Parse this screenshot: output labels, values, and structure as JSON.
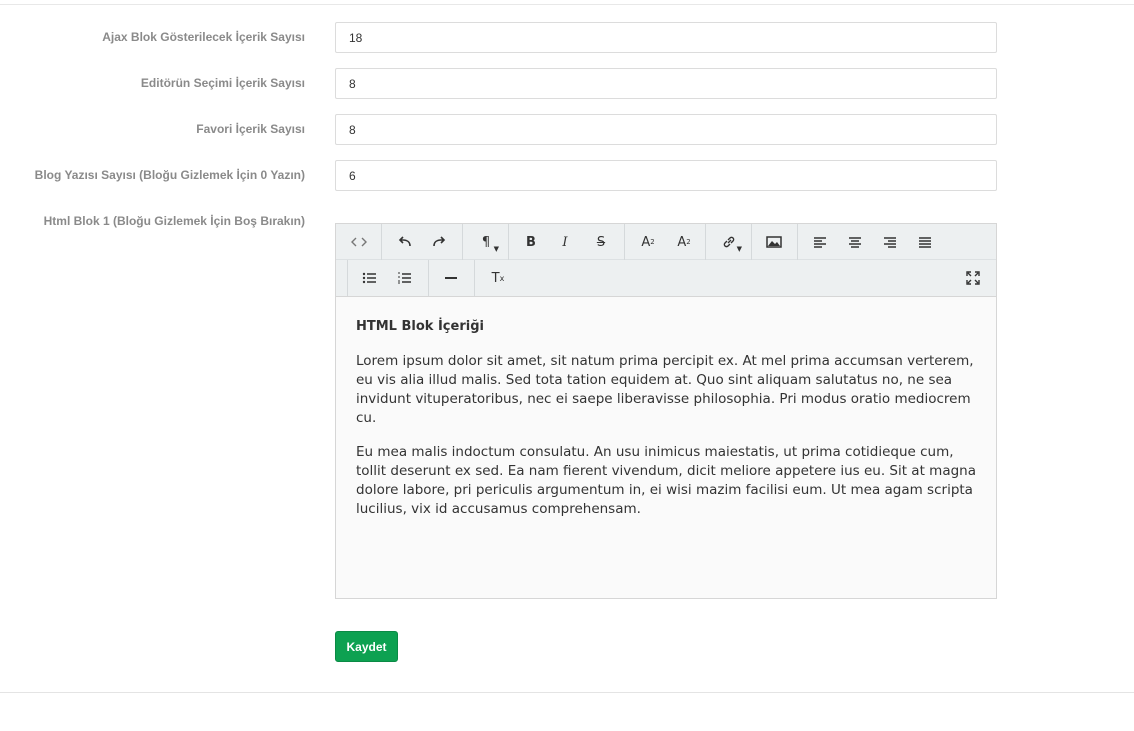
{
  "form": {
    "fields": [
      {
        "label": "Ajax Blok Gösterilecek İçerik Sayısı",
        "value": "18"
      },
      {
        "label": "Editörün Seçimi İçerik Sayısı",
        "value": "8"
      },
      {
        "label": "Favori İçerik Sayısı",
        "value": "8"
      },
      {
        "label": "Blog Yazısı Sayısı (Bloğu Gizlemek İçin 0 Yazın)",
        "value": "6"
      }
    ],
    "html_block_label": "Html Blok 1 (Bloğu Gizlemek İçin Boş Bırakın)",
    "save_label": "Kaydet"
  },
  "editor": {
    "toolbar_icons": [
      "code-view-icon",
      "undo-icon",
      "redo-icon",
      "paragraph-format-icon",
      "bold-icon",
      "italic-icon",
      "strikethrough-icon",
      "superscript-icon",
      "subscript-icon",
      "link-icon",
      "image-icon",
      "align-left-icon",
      "align-center-icon",
      "align-right-icon",
      "align-justify-icon",
      "unordered-list-icon",
      "ordered-list-icon",
      "horizontal-line-icon",
      "clear-formatting-icon",
      "fullscreen-icon"
    ],
    "heading": "HTML Blok İçeriği",
    "paragraphs": [
      "Lorem ipsum dolor sit amet, sit natum prima percipit ex. At mel prima accumsan verterem, eu vis alia illud malis. Sed tota tation equidem at. Quo sint aliquam salutatus no, ne sea invidunt vituperatoribus, nec ei saepe liberavisse philosophia. Pri modus oratio mediocrem cu.",
      "Eu mea malis indoctum consulatu. An usu inimicus maiestatis, ut prima cotidieque cum, tollit deserunt ex sed. Ea nam fierent vivendum, dicit meliore appetere ius eu. Sit at magna dolore labore, pri periculis argumentum in, ei wisi mazim facilisi eum. Ut mea agam scripta lucilius, vix id accusamus comprehensam."
    ]
  },
  "colors": {
    "save_button": "#0da151",
    "toolbar_bg": "#edf0f1",
    "label": "#8a8a8a"
  }
}
